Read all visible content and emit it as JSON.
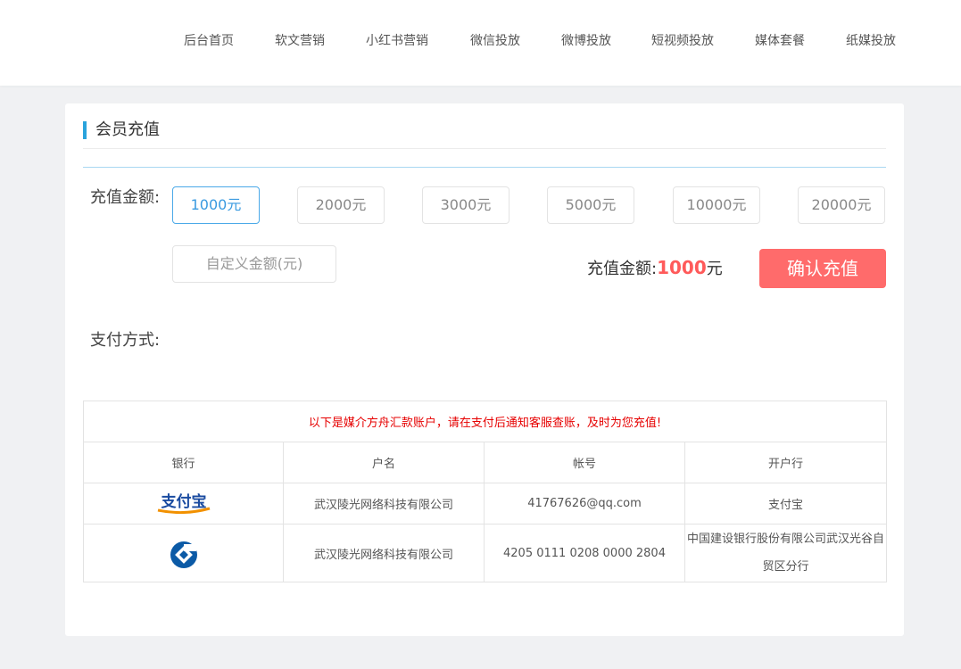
{
  "nav": {
    "items": [
      {
        "label": "后台首页"
      },
      {
        "label": "软文营销"
      },
      {
        "label": "小红书营销"
      },
      {
        "label": "微信投放"
      },
      {
        "label": "微博投放"
      },
      {
        "label": "短视频投放"
      },
      {
        "label": "媒体套餐"
      },
      {
        "label": "纸媒投放"
      }
    ]
  },
  "card": {
    "title": "会员充值",
    "amount_label": "充值金额:",
    "amounts": [
      "1000元",
      "2000元",
      "3000元",
      "5000元",
      "10000元",
      "20000元"
    ],
    "selected_amount_index": 0,
    "custom_amount_label": "自定义金额(元)",
    "summary": {
      "label": "充值金额:",
      "value": "1000",
      "unit": "元"
    },
    "confirm_label": "确认充值",
    "payment_label": "支付方式:"
  },
  "accounts": {
    "notice": "以下是媒介方舟汇款账户，请在支付后通知客服查账，及时为您充值!",
    "headers": [
      "银行",
      "户名",
      "帐号",
      "开户行"
    ],
    "rows": [
      {
        "bank_logo": "alipay-logo",
        "logo_text": "支付宝",
        "name": "武汉陵光网络科技有限公司",
        "account": "41767626@qq.com",
        "branch": "支付宝"
      },
      {
        "bank_logo": "ccb-logo",
        "name": "武汉陵光网络科技有限公司",
        "account": "4205 0111 0208 0000 2804",
        "branch": "中国建设银行股份有限公司武汉光谷自贸区分行"
      }
    ]
  },
  "colors": {
    "accent": "#29a3dc",
    "confirm": "#ff6b6b",
    "highlight": "#ff5a5a",
    "notice": "#e60000"
  }
}
